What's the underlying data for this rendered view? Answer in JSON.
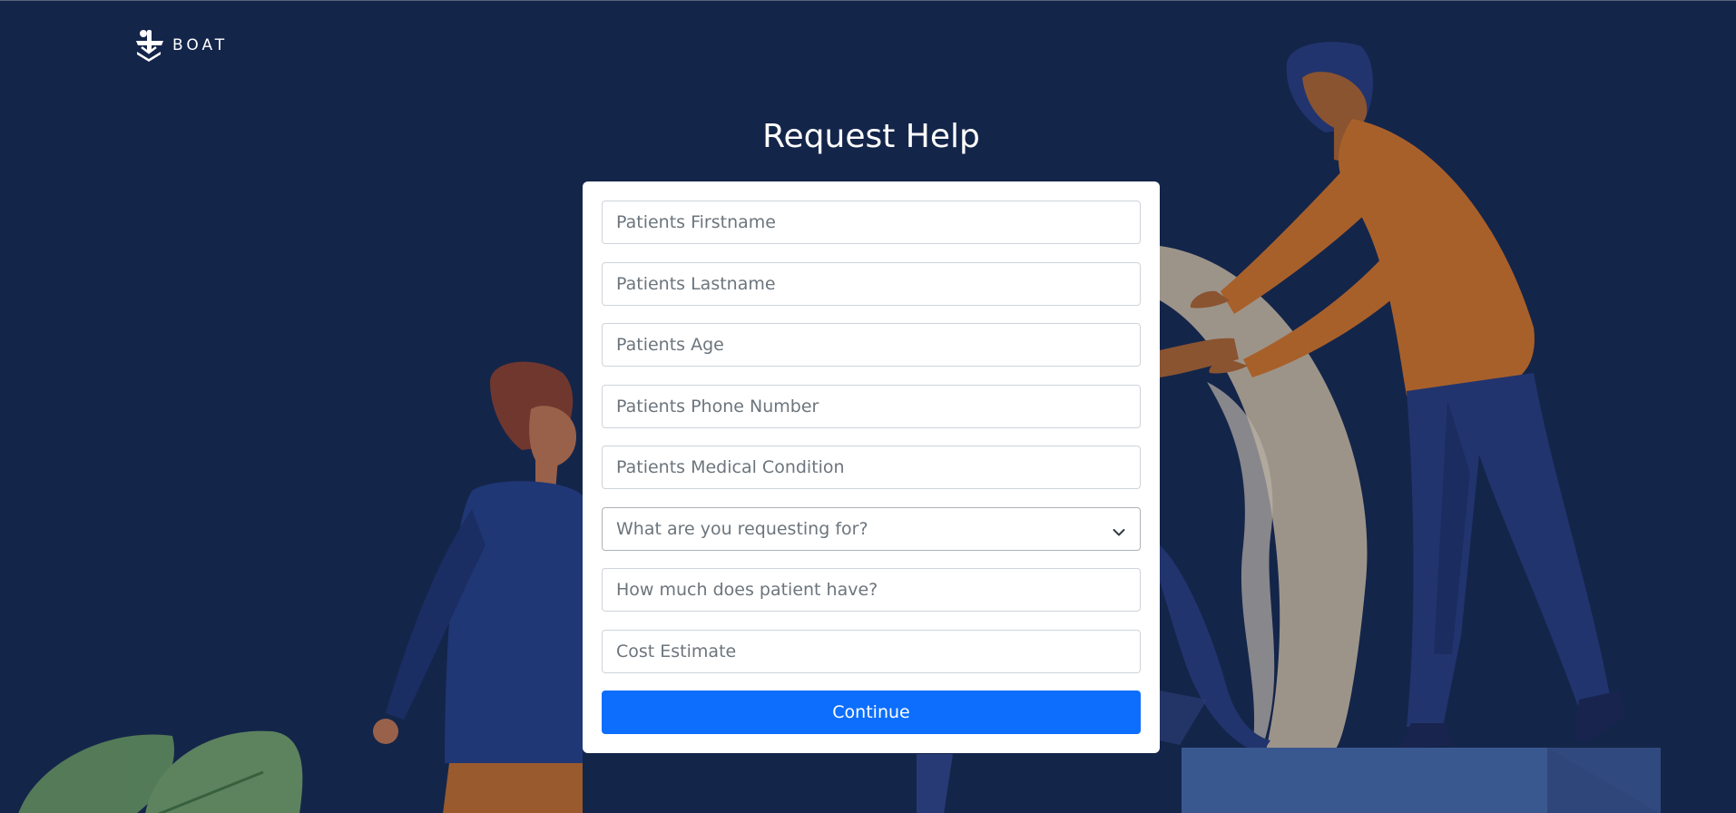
{
  "brand": {
    "name": "BOAT"
  },
  "page": {
    "title": "Request Help"
  },
  "form": {
    "firstname_placeholder": "Patients Firstname",
    "lastname_placeholder": "Patients Lastname",
    "age_placeholder": "Patients Age",
    "phone_placeholder": "Patients Phone Number",
    "condition_placeholder": "Patients Medical Condition",
    "request_select_value": "What are you requesting for?",
    "amount_placeholder": "How much does patient have?",
    "cost_placeholder": "Cost Estimate",
    "continue_label": "Continue"
  },
  "colors": {
    "background": "#14254a",
    "primary": "#0d6efd",
    "card": "#ffffff"
  },
  "icons": [
    "logo-icon",
    "chevron-down-icon"
  ]
}
